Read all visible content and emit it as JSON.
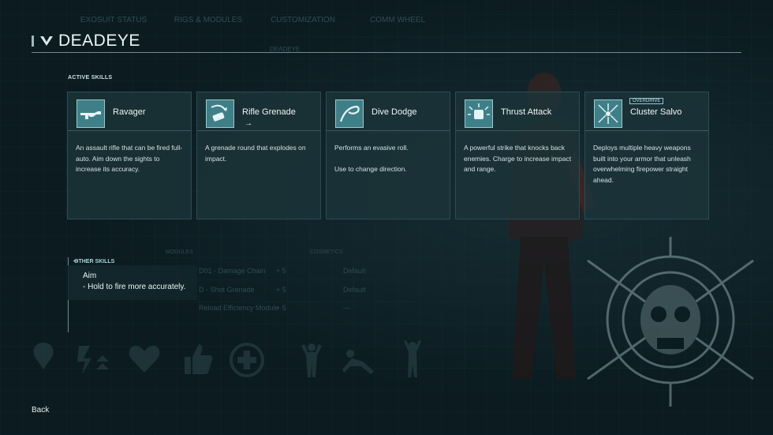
{
  "nav": {
    "tabs": [
      "EXOSUIT STATUS",
      "RIGS & MODULES",
      "CUSTOMIZATION",
      "COMM WHEEL"
    ],
    "breadcrumb": "DEADEYE"
  },
  "page": {
    "title": "DEADEYE",
    "back_label": "Back"
  },
  "active_skills": {
    "label": "ACTIVE SKILLS",
    "skills": [
      {
        "name": "Ravager",
        "icon": "rifle-icon",
        "arrow": "",
        "badge": "",
        "description": "An assault rifle that can be fired full-auto. Aim down the sights to increase its accuracy."
      },
      {
        "name": "Rifle Grenade",
        "icon": "grenade-icon",
        "arrow": "→",
        "badge": "",
        "description": "A grenade round that explodes on impact."
      },
      {
        "name": "Dive Dodge",
        "icon": "dodge-icon",
        "arrow": "",
        "badge": "",
        "description": "Performs an evasive roll.\n\nUse    to change direction."
      },
      {
        "name": "Thrust Attack",
        "icon": "thrust-fist-icon",
        "arrow": "",
        "badge": "",
        "description": "A powerful strike that knocks back enemies. Charge to increase impact and range."
      },
      {
        "name": "Cluster Salvo",
        "icon": "cluster-salvo-icon",
        "arrow": "",
        "badge": "OVERDRIVE",
        "description": "Deploys multiple heavy weapons built into your armor that unleash overwhelming firepower straight ahead."
      }
    ]
  },
  "other_skills": {
    "label": "OTHER SKILLS",
    "name": "Aim",
    "description": "- Hold     to fire more accurately."
  },
  "background": {
    "modules_label": "MODULES",
    "cosmetics_label": "COSMETICS",
    "modules": [
      "D01 - Damage Chain",
      "D - Shot Grenade",
      "Reload Efficiency Module"
    ],
    "module_levels": [
      "+ 5",
      "+ 5",
      "+ 5"
    ],
    "cosmetics": [
      "Default",
      "Default",
      "---"
    ]
  }
}
